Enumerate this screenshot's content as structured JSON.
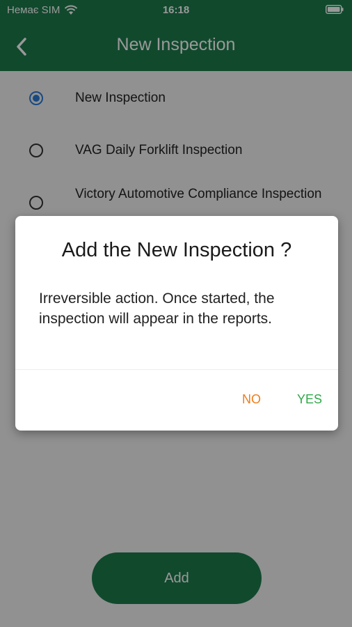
{
  "status_bar": {
    "carrier": "Немає SIM",
    "time": "16:18"
  },
  "nav": {
    "title": "New Inspection"
  },
  "options": [
    {
      "label": "New Inspection",
      "selected": true
    },
    {
      "label": "VAG Daily Forklift Inspection",
      "selected": false
    },
    {
      "label": "Victory Automotive Compliance Inspection",
      "selected": false
    }
  ],
  "add_button": {
    "label": "Add"
  },
  "dialog": {
    "title": "Add the New Inspection ?",
    "message": "Irreversible action. Once started, the inspection will appear in the reports.",
    "no_label": "NO",
    "yes_label": "YES"
  },
  "colors": {
    "primary": "#1d7a4b",
    "radio_selected": "#2a7ad8",
    "no_button": "#ef7d1a",
    "yes_button": "#2fa84a"
  }
}
